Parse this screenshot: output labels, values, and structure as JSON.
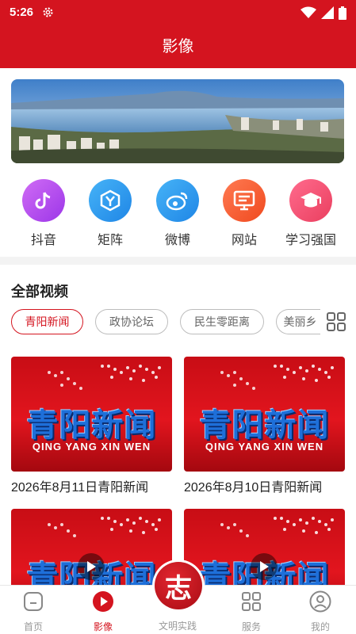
{
  "status_bar": {
    "time": "5:26",
    "icons": [
      "settings-icon",
      "wifi-icon",
      "signal-icon",
      "battery-icon"
    ]
  },
  "header": {
    "title": "影像"
  },
  "quick_links": [
    {
      "label": "抖音",
      "icon": "tiktok-icon",
      "color": "#b145f0"
    },
    {
      "label": "矩阵",
      "icon": "matrix-icon",
      "color": "#2e9bf0"
    },
    {
      "label": "微博",
      "icon": "weibo-icon",
      "color": "#2e9bf0"
    },
    {
      "label": "网站",
      "icon": "website-icon",
      "color": "#f25b2f"
    },
    {
      "label": "学习强国",
      "icon": "study-icon",
      "color": "#f0456b"
    }
  ],
  "section": {
    "title": "全部视频",
    "chips": [
      {
        "label": "青阳新闻",
        "active": true
      },
      {
        "label": "政协论坛",
        "active": false
      },
      {
        "label": "民生零距离",
        "active": false
      },
      {
        "label": "美丽乡",
        "active": false
      }
    ]
  },
  "videos": [
    {
      "thumb_title": "青阳新闻",
      "thumb_sub": "QING YANG  XIN WEN",
      "caption": "2026年8月11日青阳新闻"
    },
    {
      "thumb_title": "青阳新闻",
      "thumb_sub": "QING YANG  XIN WEN",
      "caption": "2026年8月10日青阳新闻"
    },
    {
      "thumb_title": "青阳新闻",
      "thumb_sub": "",
      "caption": ""
    },
    {
      "thumb_title": "青阳新闻",
      "thumb_sub": "",
      "caption": ""
    }
  ],
  "bottom_nav": [
    {
      "label": "首页",
      "icon": "home-icon",
      "active": false
    },
    {
      "label": "影像",
      "icon": "video-play-icon",
      "active": true
    },
    {
      "label": "文明实践",
      "icon": "zhi-logo-icon",
      "active": false,
      "center_glyph": "志"
    },
    {
      "label": "服务",
      "icon": "grid-icon",
      "active": false
    },
    {
      "label": "我的",
      "icon": "user-icon",
      "active": false
    }
  ],
  "colors": {
    "brand_red": "#d4141f",
    "chip_inactive": "#bdbdbd",
    "nav_inactive": "#999999"
  }
}
